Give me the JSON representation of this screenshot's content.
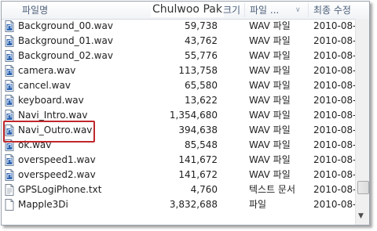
{
  "header": {
    "name_label": "파일명",
    "size_label": "크기",
    "type_label": "파일 ...",
    "date_label": "최종 수정",
    "watermark": "Chulwoo Pak"
  },
  "files": [
    {
      "name": "Background_00.wav",
      "size": "59,738",
      "type": "WAV 파일",
      "date": "2010-08-",
      "icon": "audio-file-icon"
    },
    {
      "name": "Background_01.wav",
      "size": "43,762",
      "type": "WAV 파일",
      "date": "2010-08-",
      "icon": "audio-file-icon"
    },
    {
      "name": "Background_02.wav",
      "size": "55,776",
      "type": "WAV 파일",
      "date": "2010-08-",
      "icon": "audio-file-icon"
    },
    {
      "name": "camera.wav",
      "size": "113,758",
      "type": "WAV 파일",
      "date": "2010-08-",
      "icon": "audio-file-icon"
    },
    {
      "name": "cancel.wav",
      "size": "65,580",
      "type": "WAV 파일",
      "date": "2010-08-",
      "icon": "audio-file-icon"
    },
    {
      "name": "keyboard.wav",
      "size": "13,622",
      "type": "WAV 파일",
      "date": "2010-08-",
      "icon": "audio-file-icon"
    },
    {
      "name": "Navi_Intro.wav",
      "size": "1,354,680",
      "type": "WAV 파일",
      "date": "2010-08-",
      "icon": "audio-file-icon"
    },
    {
      "name": "Navi_Outro.wav",
      "size": "394,638",
      "type": "WAV 파일",
      "date": "2010-08-",
      "icon": "audio-file-icon"
    },
    {
      "name": "ok.wav",
      "size": "85,548",
      "type": "WAV 파일",
      "date": "2010-08-",
      "icon": "audio-file-icon"
    },
    {
      "name": "overspeed1.wav",
      "size": "141,672",
      "type": "WAV 파일",
      "date": "2010-08-",
      "icon": "audio-file-icon"
    },
    {
      "name": "overspeed2.wav",
      "size": "141,672",
      "type": "WAV 파일",
      "date": "2010-08-",
      "icon": "audio-file-icon"
    },
    {
      "name": "GPSLogiPhone.txt",
      "size": "4,760",
      "type": "텍스트 문서",
      "date": "2010-08-",
      "icon": "text-file-icon"
    },
    {
      "name": "Mapple3Di",
      "size": "3,832,688",
      "type": "파일",
      "date": "2010-08-",
      "icon": "file-icon"
    }
  ],
  "colors": {
    "header_text": "#4c607a",
    "highlight_box": "#c0272d",
    "icon_blue": "#2f66b3"
  }
}
